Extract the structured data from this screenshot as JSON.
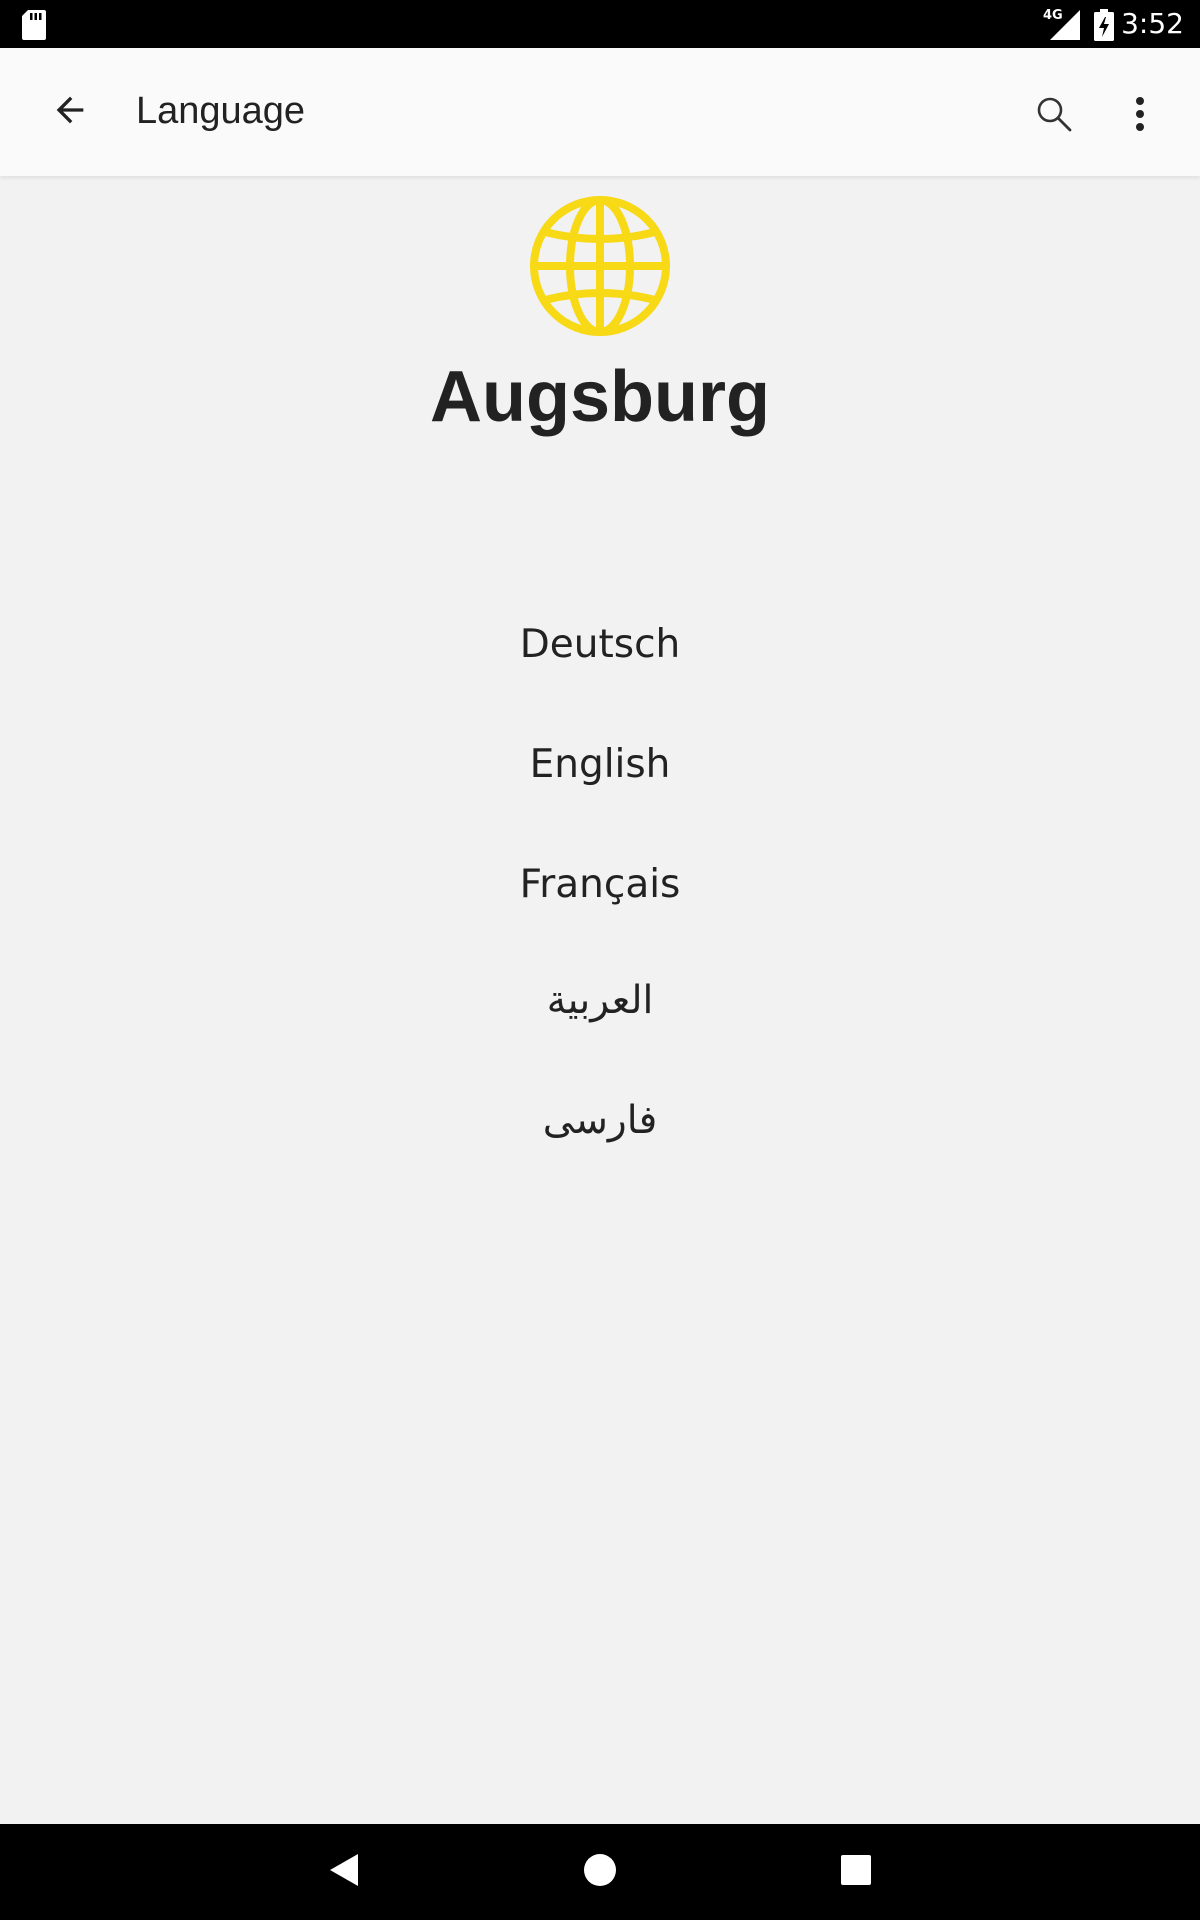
{
  "status_bar": {
    "network": "4G",
    "time": "3:52",
    "icons": [
      "sd-card-icon",
      "signal-icon",
      "battery-charging-icon"
    ]
  },
  "app_bar": {
    "title": "Language",
    "icons": [
      "back-arrow-icon",
      "search-icon",
      "more-vert-icon"
    ]
  },
  "header": {
    "icon": "globe-icon",
    "icon_color": "#f7d916",
    "city": "Augsburg"
  },
  "languages": [
    "Deutsch",
    "English",
    "Français",
    "العربية",
    "فارسی"
  ],
  "nav_bar": {
    "icons": [
      "back-triangle-icon",
      "home-circle-icon",
      "recents-square-icon"
    ]
  }
}
